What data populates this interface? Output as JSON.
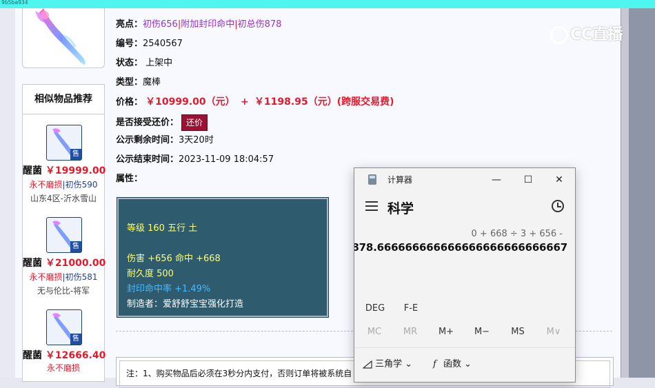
{
  "topbar": {
    "id_text": "9b5ba934"
  },
  "item": {
    "highlights_label": "亮点：",
    "highlights": [
      "初伤656",
      "附加封印命中",
      "初总伤878"
    ],
    "id_label": "编号：",
    "id_value": "2540567",
    "status_label": "状态：",
    "status_value": "上架中",
    "type_label": "类型：",
    "type_value": "魔棒",
    "price_label": "价格：",
    "price_value": "￥10999.00（元）",
    "price_plus": "+",
    "fee_value": "￥1198.95（元）(跨服交易费)",
    "counter_label": "是否接受还价：",
    "counter_button": "还价",
    "remain_label": "公示剩余时间：",
    "remain_value": "3天20时",
    "end_label": "公示结束时间：",
    "end_value": "2023-11-09 18:04:57",
    "attr_label": "属性："
  },
  "attributes": {
    "level": "等级 160 五行 土",
    "damage": "伤害 +656 命中 +668",
    "durability": "耐久度 500",
    "seal": "封印命中率 +1.49%",
    "maker": "制造者：爱舒舒宝宝强化打造"
  },
  "similar": {
    "title": "相似物品推荐",
    "sell_badge": "售",
    "items": [
      {
        "name": "醒菌",
        "price": "￥19999.00",
        "tag_a": "永不磨损",
        "tag_sep": "|",
        "tag_b": "初伤590",
        "server": "山东4区-沂水雪山"
      },
      {
        "name": "醒菌",
        "price": "￥21000.00",
        "tag_a": "永不磨损",
        "tag_sep": "|",
        "tag_b": "初伤581",
        "server": "无与伦比-将军"
      },
      {
        "name": "醒菌",
        "price": "￥12666.40",
        "tag_a": "永不磨损",
        "tag_sep": "",
        "tag_b": "",
        "server": ""
      }
    ]
  },
  "notice": {
    "text": "注：1、购买物品后必须在3秒分内支付，否则订单将被系统自"
  },
  "logo": {
    "text": "CC直播"
  },
  "calculator": {
    "title": "计算器",
    "mode": "科学",
    "expression": "0 + 668 ÷ 3 + 656 -",
    "result": "878.666666666666666666666666667",
    "win_minimize": "—",
    "win_maximize": "☐",
    "win_close": "✕",
    "angle": "DEG",
    "fe": "F-E",
    "mem_keys": [
      "MC",
      "MR",
      "M+",
      "M−",
      "MS",
      "M∨"
    ],
    "trig": "三角学",
    "func": "函数",
    "func_symbol": "f"
  }
}
